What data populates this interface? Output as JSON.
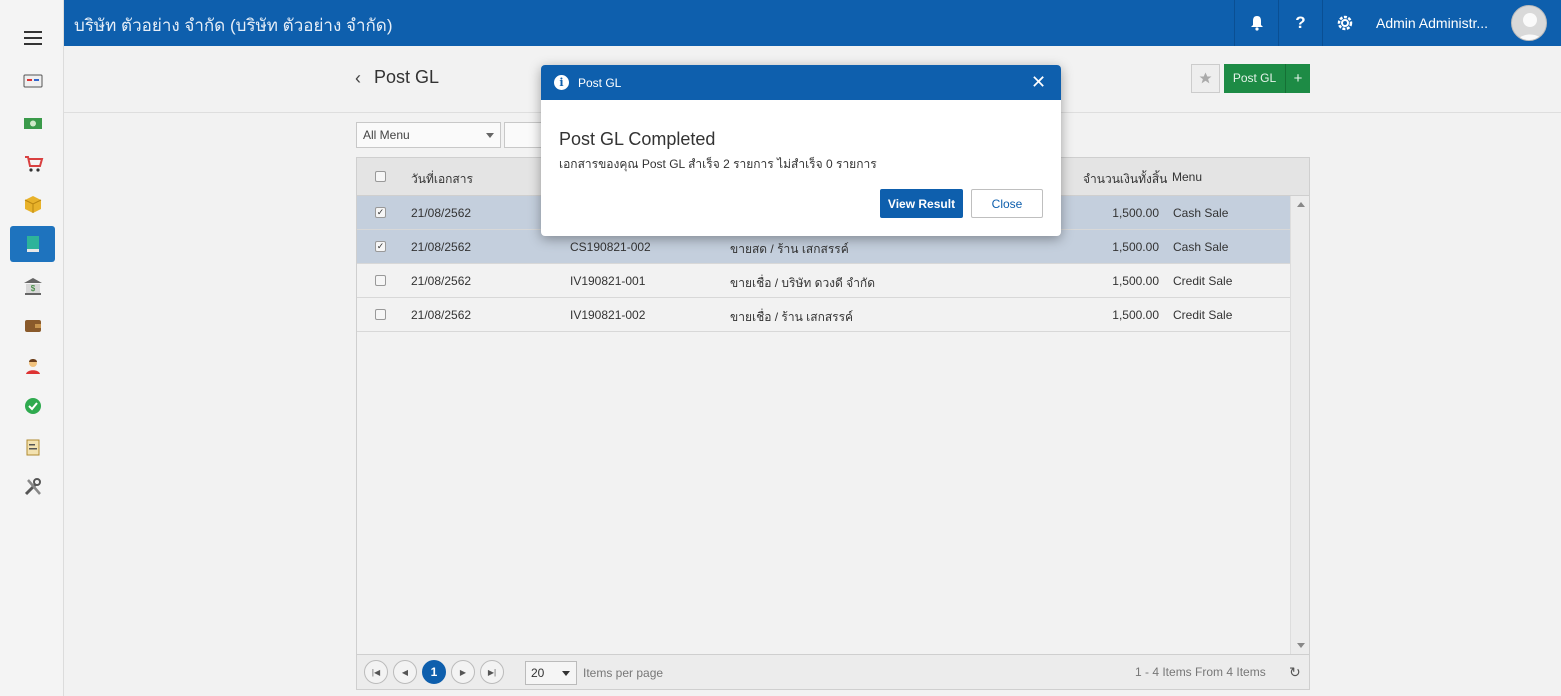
{
  "header": {
    "company": "บริษัท ตัวอย่าง จำกัด (บริษัท ตัวอย่าง จำกัด)",
    "user_name": "Admin Administr...",
    "icons": [
      "bell-icon",
      "help-icon",
      "settings-icon"
    ]
  },
  "sidebar": {
    "items": [
      {
        "name": "dashboard",
        "icon": "card-icon"
      },
      {
        "name": "money",
        "icon": "money-icon"
      },
      {
        "name": "purchase",
        "icon": "cart-icon"
      },
      {
        "name": "inventory",
        "icon": "box-icon"
      },
      {
        "name": "accounting",
        "icon": "book-icon",
        "active": true
      },
      {
        "name": "bank",
        "icon": "bank-icon"
      },
      {
        "name": "wallet",
        "icon": "wallet-icon"
      },
      {
        "name": "employee",
        "icon": "person-icon"
      },
      {
        "name": "approve",
        "icon": "check-icon"
      },
      {
        "name": "report",
        "icon": "report-icon"
      },
      {
        "name": "tools",
        "icon": "tools-icon"
      }
    ]
  },
  "page": {
    "title": "Post GL",
    "post_button": "Post GL",
    "add_symbol": "+",
    "filter_menu": "All Menu"
  },
  "table": {
    "columns": [
      "วันที่เอกสาร",
      "จำนวนเงินทั้งสิ้น",
      "Menu"
    ],
    "rows": [
      {
        "date": "21/08/2562",
        "doc_no": "",
        "desc": "",
        "amount": "1,500.00",
        "menu": "Cash Sale",
        "checked": true
      },
      {
        "date": "21/08/2562",
        "doc_no": "CS190821-002",
        "desc": "ขายสด / ร้าน เสกสรรค์",
        "amount": "1,500.00",
        "menu": "Cash Sale",
        "checked": true
      },
      {
        "date": "21/08/2562",
        "doc_no": "IV190821-001",
        "desc": "ขายเชื่อ / บริษัท ดวงดี จำกัด",
        "amount": "1,500.00",
        "menu": "Credit Sale",
        "checked": false
      },
      {
        "date": "21/08/2562",
        "doc_no": "IV190821-002",
        "desc": "ขายเชื่อ / ร้าน เสกสรรค์",
        "amount": "1,500.00",
        "menu": "Credit Sale",
        "checked": false
      }
    ]
  },
  "pager": {
    "current_page": "1",
    "page_size": "20",
    "items_per_page": "Items per page",
    "info": "1 - 4 Items From 4 Items"
  },
  "modal": {
    "title": "Post GL",
    "heading": "Post GL Completed",
    "message": "เอกสารของคุณ Post GL สำเร็จ 2 รายการ ไม่สำเร็จ 0 รายการ",
    "view_result": "View Result",
    "close": "Close"
  },
  "colors": {
    "header": "#0e5fad",
    "post_button": "#1d8b45",
    "selected_row": "#c4cfdd"
  }
}
